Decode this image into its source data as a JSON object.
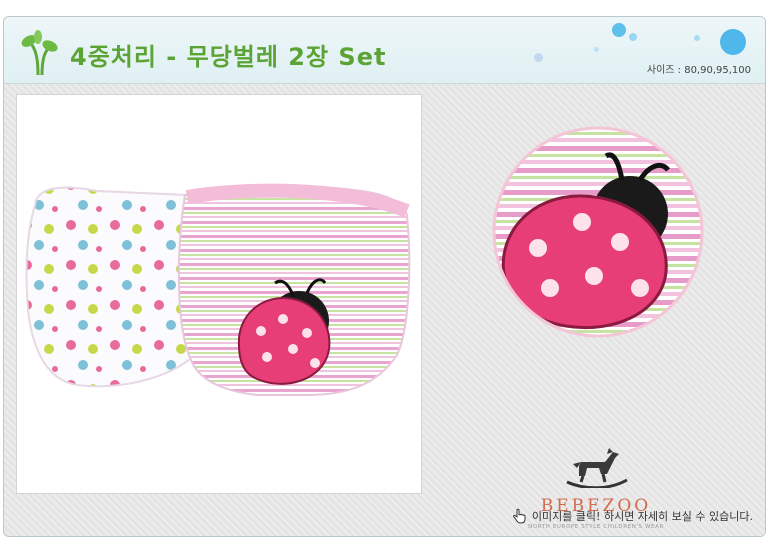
{
  "header": {
    "title": "4중처리 - 무당벌레 2장 Set",
    "size_label": "사이즈 : 80,90,95,100"
  },
  "brand": {
    "name": "BEBEZOO",
    "tagline": "NORTH EUROPE STYLE CHILDREN'S WEAR"
  },
  "hint": {
    "text": "이미지를 클릭! 하시면 자세히 보실 수 있습니다."
  },
  "icons": {
    "logo": "sprout-icon",
    "hint": "hand-pointer-icon",
    "brand": "rocking-horse-icon"
  },
  "colors": {
    "title": "#5aa334",
    "brand": "#d36a4d",
    "ladybug": "#e83e77"
  }
}
